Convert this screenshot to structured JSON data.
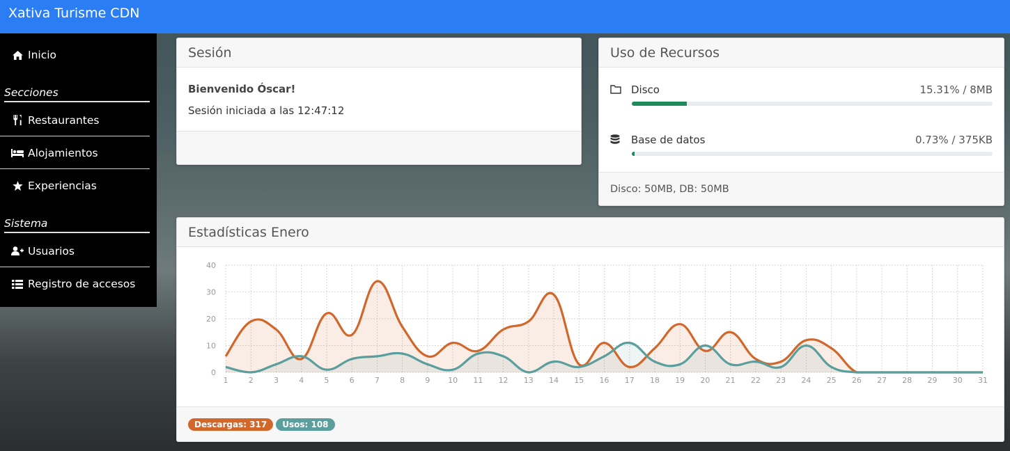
{
  "app": {
    "title": "Xativa Turisme CDN"
  },
  "sidebar": {
    "items": [
      {
        "label": "Inicio",
        "icon": "home-icon"
      },
      {
        "label": "Restaurantes",
        "icon": "utensils-icon"
      },
      {
        "label": "Alojamientos",
        "icon": "bed-icon"
      },
      {
        "label": "Experiencias",
        "icon": "star-icon"
      },
      {
        "label": "Usuarios",
        "icon": "user-plus-icon"
      },
      {
        "label": "Registro de accesos",
        "icon": "list-icon"
      }
    ],
    "sections": [
      "Secciones",
      "Sistema"
    ]
  },
  "session": {
    "title": "Sesión",
    "welcome": "Bienvenido Óscar!",
    "started": "Sesión iniciada a las 12:47:12"
  },
  "resources": {
    "title": "Uso de Recursos",
    "disk": {
      "label": "Disco",
      "value": "15.31% / 8MB",
      "percent": 15.31
    },
    "db": {
      "label": "Base de datos",
      "value": "0.73% / 375KB",
      "percent": 0.73
    },
    "footer": "Disco: 50MB, DB: 50MB"
  },
  "stats": {
    "title": "Estadísticas Enero",
    "badges": {
      "downloads": "Descargas: 317",
      "uses": "Usos: 108"
    }
  },
  "colors": {
    "accent": "#2a7df3",
    "downloads": "#d2672b",
    "uses": "#5a9e9e",
    "disk_bar": "#1e8a5c"
  },
  "chart_data": {
    "type": "area",
    "x": [
      1,
      2,
      3,
      4,
      5,
      6,
      7,
      8,
      9,
      10,
      11,
      12,
      13,
      14,
      15,
      16,
      17,
      18,
      19,
      20,
      21,
      22,
      23,
      24,
      25,
      26,
      27,
      28,
      29,
      30,
      31
    ],
    "ylim": [
      0,
      40
    ],
    "yticks": [
      0,
      10,
      20,
      30,
      40
    ],
    "grid": true,
    "series": [
      {
        "name": "Descargas",
        "color": "#d2672b",
        "values": [
          6,
          19,
          16,
          5,
          22,
          14,
          34,
          17,
          6,
          11,
          8,
          16,
          19,
          29,
          3,
          11,
          2,
          9,
          18,
          8,
          15,
          5,
          4,
          12,
          9,
          0,
          0,
          0,
          0,
          0,
          0
        ]
      },
      {
        "name": "Usos",
        "color": "#5a9e9e",
        "values": [
          2,
          0,
          3,
          6,
          1,
          5,
          6,
          7,
          3,
          1,
          7,
          6,
          0,
          4,
          2,
          6,
          11,
          4,
          3,
          10,
          3,
          4,
          2,
          10,
          2,
          0,
          0,
          0,
          0,
          0,
          0
        ]
      }
    ]
  }
}
